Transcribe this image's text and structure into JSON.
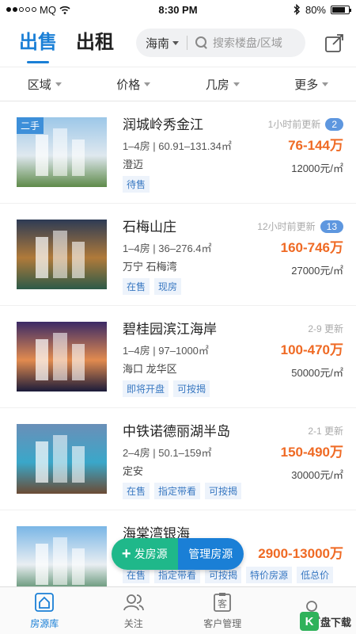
{
  "status_bar": {
    "carrier": "MQ",
    "time": "8:30 PM",
    "battery": "80%",
    "battery_level": 0.8
  },
  "header": {
    "tabs": [
      {
        "label": "出售"
      },
      {
        "label": "出租"
      }
    ],
    "city": "海南",
    "search_placeholder": "搜索楼盘/区域"
  },
  "filters": [
    {
      "label": "区域"
    },
    {
      "label": "价格"
    },
    {
      "label": "几房"
    },
    {
      "label": "更多"
    }
  ],
  "listings": [
    {
      "badge": "二手",
      "title": "润城岭秀金江",
      "spec": "1–4房 | 60.91–131.34㎡",
      "location": "澄迈",
      "tags": [
        "待售"
      ],
      "updated": "1小时前更新",
      "count": "2",
      "price": "76-144万",
      "unit_price": "12000元/㎡",
      "palette": [
        "#9cc7e8",
        "#dfe8ef",
        "#5e8a4a"
      ]
    },
    {
      "badge": "",
      "title": "石梅山庄",
      "spec": "1–4房 | 36–276.4㎡",
      "location": "万宁 石梅湾",
      "tags": [
        "在售",
        "现房"
      ],
      "updated": "12小时前更新",
      "count": "13",
      "price": "160-746万",
      "unit_price": "27000元/㎡",
      "palette": [
        "#2d3b55",
        "#b07a3a",
        "#2c5a48"
      ]
    },
    {
      "badge": "",
      "title": "碧桂园滨江海岸",
      "spec": "1–4房 | 97–1000㎡",
      "location": "海口 龙华区",
      "tags": [
        "即将开盘",
        "可按揭"
      ],
      "updated": "2-9 更新",
      "count": "",
      "price": "100-470万",
      "unit_price": "50000元/㎡",
      "palette": [
        "#3b2a66",
        "#e28b4f",
        "#1b1b3a"
      ]
    },
    {
      "badge": "",
      "title": "中铁诺德丽湖半岛",
      "spec": "2–4房 | 50.1–159㎡",
      "location": "定安",
      "tags": [
        "在售",
        "指定带看",
        "可按揭"
      ],
      "updated": "2-1 更新",
      "count": "",
      "price": "150-490万",
      "unit_price": "30000元/㎡",
      "palette": [
        "#6a8fb8",
        "#3aa7c9",
        "#6b4b35"
      ]
    },
    {
      "badge": "",
      "title": "海棠湾银海",
      "spec": "",
      "location": "三亚 海棠湾",
      "tags": [
        "在售",
        "指定带看",
        "可按揭",
        "特价房源",
        "低总价"
      ],
      "updated": "",
      "count": "",
      "price": "2900-13000万",
      "unit_price": "",
      "palette": [
        "#7ab6e6",
        "#e9eef2",
        "#3c7a52"
      ]
    }
  ],
  "actions": {
    "publish": "发房源",
    "manage": "管理房源"
  },
  "tabbar": [
    {
      "label": "房源库",
      "icon": "house-icon"
    },
    {
      "label": "关注",
      "icon": "people-icon"
    },
    {
      "label": "客户管理",
      "icon": "customer-icon"
    },
    {
      "label": "",
      "icon": "profile-icon"
    }
  ],
  "watermark": {
    "logo": "K",
    "text": "盘下载"
  },
  "colors": {
    "accent": "#1a7fd6",
    "price": "#ef6a24",
    "green": "#1fb88a"
  }
}
